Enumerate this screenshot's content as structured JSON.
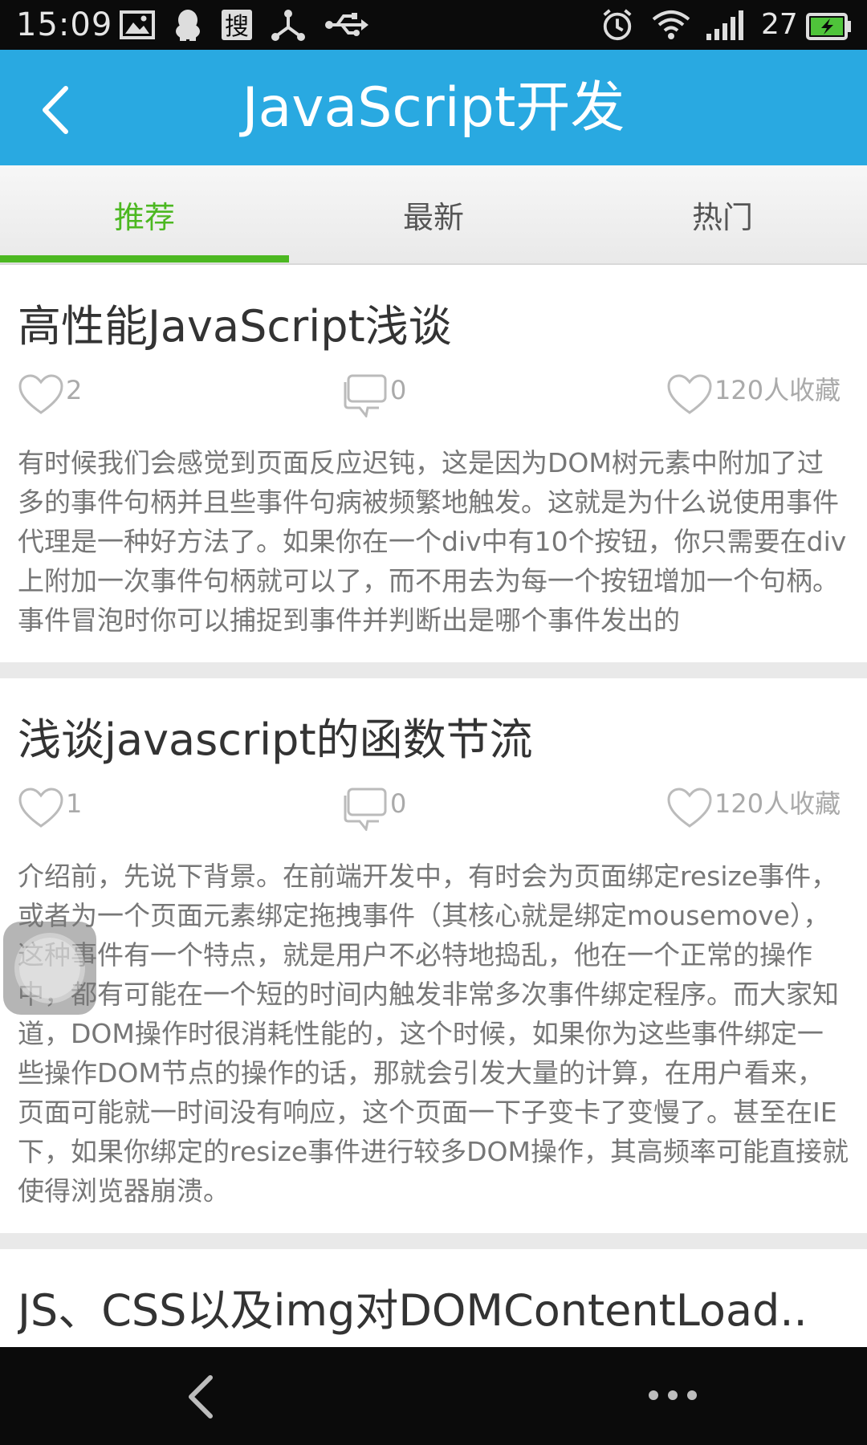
{
  "status_bar": {
    "time": "15:09",
    "left_icons": [
      "image-icon",
      "qq-icon",
      "sogou-icon",
      "share-network-icon",
      "usb-icon"
    ],
    "right_icons": [
      "alarm-icon",
      "wifi-icon",
      "signal-icon",
      "battery-icon"
    ],
    "battery_level": "27"
  },
  "header": {
    "back_icon": "chevron-left-icon",
    "title": "JavaScript开发",
    "background": "#29a9e1"
  },
  "tabs": {
    "items": [
      {
        "label": "推荐",
        "active": true
      },
      {
        "label": "最新",
        "active": false
      },
      {
        "label": "热门",
        "active": false
      }
    ],
    "active_color": "#4cb821"
  },
  "articles": [
    {
      "title": "高性能JavaScript浅谈",
      "likes": "2",
      "comments": "0",
      "favorites": "120人收藏",
      "summary": "有时候我们会感觉到页面反应迟钝，这是因为DOM树元素中附加了过多的事件句柄并且些事件句病被频繁地触发。这就是为什么说使用事件代理是一种好方法了。如果你在一个div中有10个按钮，你只需要在div上附加一次事件句柄就可以了，而不用去为每一个按钮增加一个句柄。事件冒泡时你可以捕捉到事件并判断出是哪个事件发出的"
    },
    {
      "title": "浅谈javascript的函数节流",
      "likes": "1",
      "comments": "0",
      "favorites": "120人收藏",
      "summary": "介绍前，先说下背景。在前端开发中，有时会为页面绑定resize事件，或者为一个页面元素绑定拖拽事件（其核心就是绑定mousemove），这种事件有一个特点，就是用户不必特地捣乱，他在一个正常的操作中，都有可能在一个短的时间内触发非常多次事件绑定程序。而大家知道，DOM操作时很消耗性能的，这个时候，如果你为这些事件绑定一些操作DOM节点的操作的话，那就会引发大量的计算，在用户看来，页面可能就一时间没有响应，这个页面一下子变卡了变慢了。甚至在IE下，如果你绑定的resize事件进行较多DOM操作，其高频率可能直接就使得浏览器崩溃。"
    },
    {
      "title": "JS、CSS以及img对DOMContentLoad..",
      "likes": "",
      "comments": "",
      "favorites": "",
      "summary": ""
    }
  ],
  "nav_bar": {
    "back_icon": "back-triangle-icon",
    "menu_icon": "more-dots-icon"
  }
}
